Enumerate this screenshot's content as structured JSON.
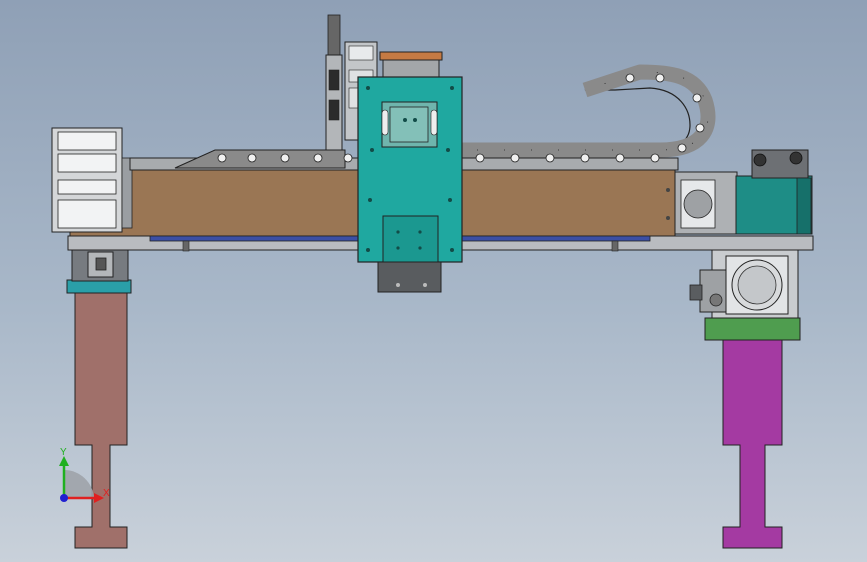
{
  "scene": {
    "background_top": "#8fa0b6",
    "background_bottom": "#c9d1da",
    "colors": {
      "beam_wood": "#9a7654",
      "carriage_teal": "#1fa8a0",
      "left_leg": "#a0706a",
      "right_leg": "#a43aa2",
      "green_plate": "#4f9d4f",
      "rail_blue": "#3b4fa5",
      "chain_gray": "#8a8a8a",
      "metal_gray": "#8c8f93"
    }
  },
  "triad": {
    "x_label": "X",
    "y_label": "Y",
    "x_color": "#e02020",
    "y_color": "#20b020",
    "z_color": "#2020d0",
    "icon": "coordinate-triad-icon"
  }
}
